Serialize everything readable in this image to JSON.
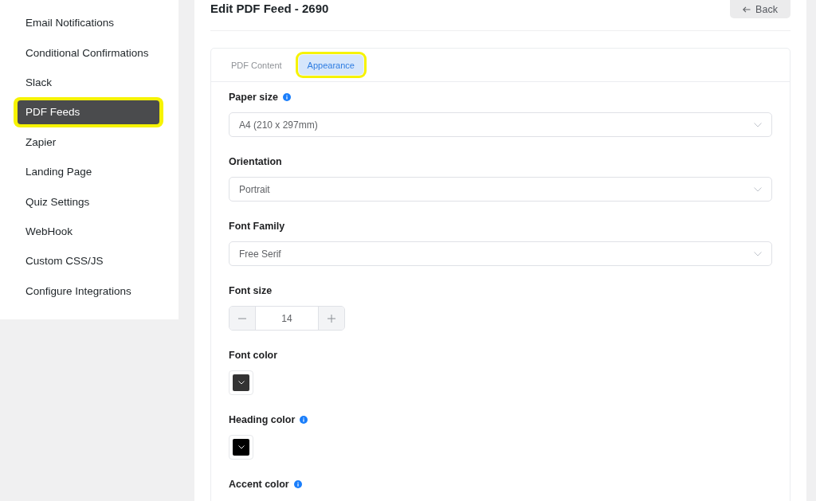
{
  "sidebar": {
    "items": [
      {
        "label": "Email Notifications",
        "selected": false,
        "highlighted": false
      },
      {
        "label": "Conditional Confirmations",
        "selected": false,
        "highlighted": false
      },
      {
        "label": "Slack",
        "selected": false,
        "highlighted": false
      },
      {
        "label": "PDF Feeds",
        "selected": true,
        "highlighted": true
      },
      {
        "label": "Zapier",
        "selected": false,
        "highlighted": false
      },
      {
        "label": "Landing Page",
        "selected": false,
        "highlighted": false
      },
      {
        "label": "Quiz Settings",
        "selected": false,
        "highlighted": false
      },
      {
        "label": "WebHook",
        "selected": false,
        "highlighted": false
      },
      {
        "label": "Custom CSS/JS",
        "selected": false,
        "highlighted": false
      },
      {
        "label": "Configure Integrations",
        "selected": false,
        "highlighted": false
      }
    ]
  },
  "header": {
    "title": "Edit PDF Feed - 2690",
    "back_button": "Back"
  },
  "tabs": [
    {
      "label": "PDF Content",
      "selected": false,
      "highlighted": false
    },
    {
      "label": "Appearance",
      "selected": true,
      "highlighted": true
    }
  ],
  "fields": [
    {
      "kind": "select",
      "label": "Paper size",
      "info": true,
      "value": "A4 (210 x 297mm)"
    },
    {
      "kind": "select",
      "label": "Orientation",
      "info": false,
      "value": "Portrait"
    },
    {
      "kind": "select",
      "label": "Font Family",
      "info": false,
      "value": "Free Serif"
    },
    {
      "kind": "number",
      "label": "Font size",
      "info": false,
      "value": "14"
    },
    {
      "kind": "color",
      "label": "Font color",
      "info": false,
      "color": "#333333"
    },
    {
      "kind": "color",
      "label": "Heading color",
      "info": true,
      "color": "#000000"
    },
    {
      "kind": "heading",
      "label": "Accent color",
      "info": true
    }
  ]
}
